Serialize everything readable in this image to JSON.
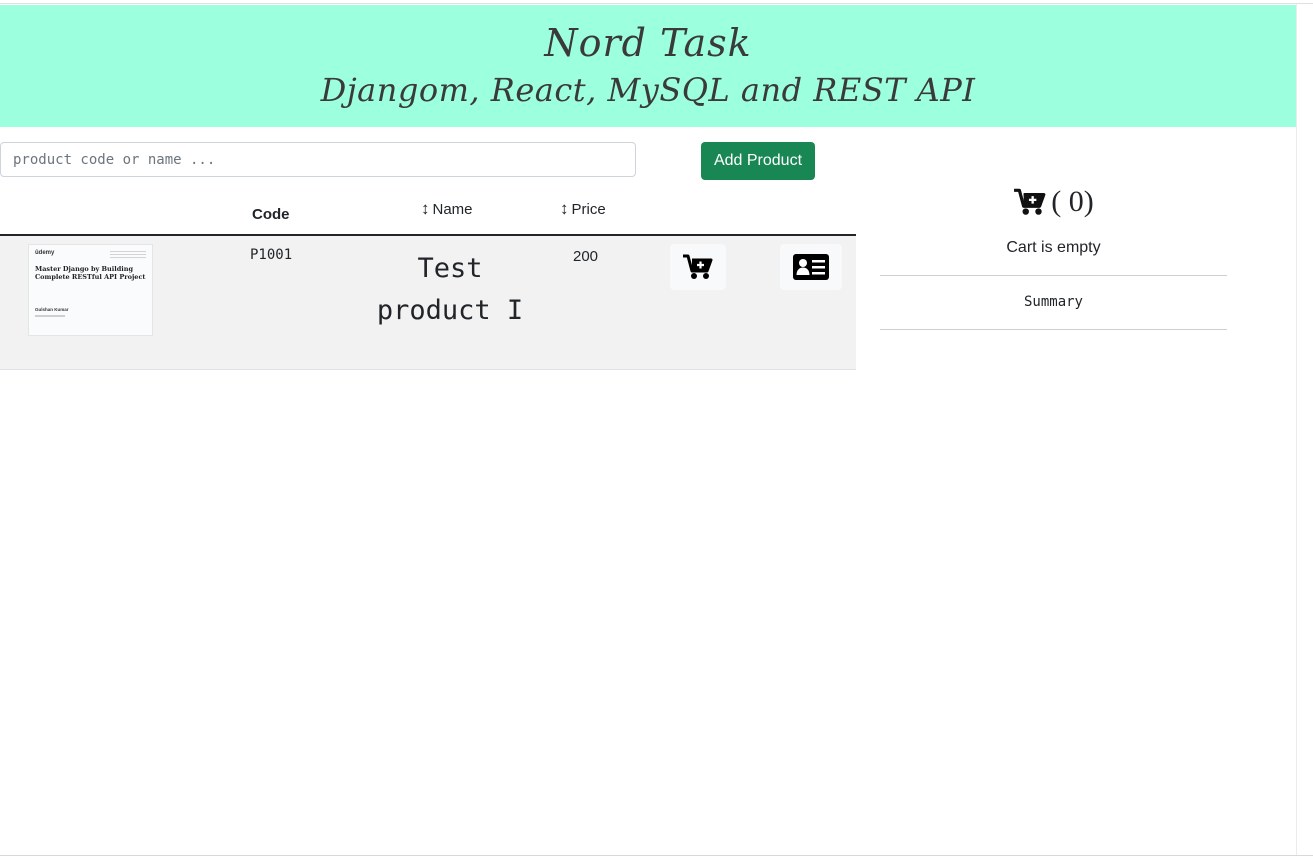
{
  "header": {
    "title": "Nord Task",
    "subtitle": "Djangom, React, MySQL and REST API",
    "background": "#9cffdd"
  },
  "search": {
    "placeholder": "product code or name ...",
    "value": ""
  },
  "toolbar": {
    "add_label": "Add Product",
    "add_color": "#198754"
  },
  "table": {
    "headers": {
      "code": "Code",
      "name": "Name",
      "price": "Price"
    },
    "sort_icon": "sort-arrows-icon",
    "rows": [
      {
        "code": "P1001",
        "name": "Test product I",
        "price": "200",
        "thumbnail": {
          "brand": "ûdemy",
          "course": "Master Django by Building Complete RESTful API Project",
          "author": "Gulshan Kumar"
        },
        "actions": [
          "add-to-cart-icon",
          "detail-card-icon"
        ]
      }
    ]
  },
  "cart": {
    "icon": "cart-plus-icon",
    "count_text": "( 0)",
    "empty_text": "Cart is empty",
    "summary_label": "Summary"
  }
}
